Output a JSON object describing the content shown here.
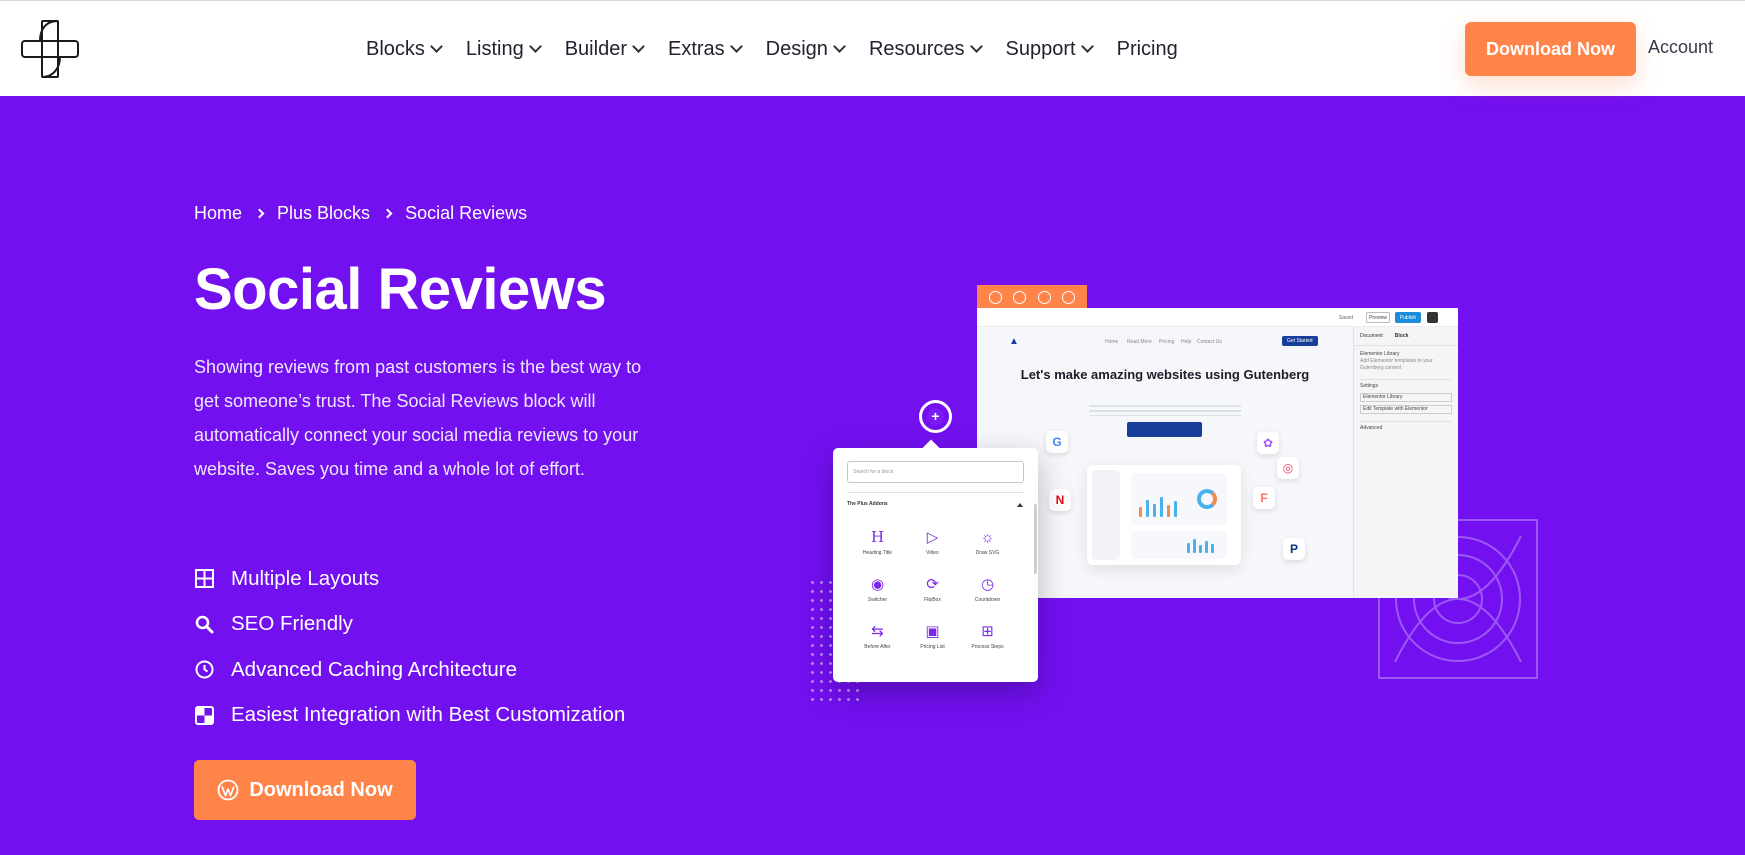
{
  "header": {
    "nav": [
      {
        "label": "Blocks",
        "dropdown": true
      },
      {
        "label": "Listing",
        "dropdown": true
      },
      {
        "label": "Builder",
        "dropdown": true
      },
      {
        "label": "Extras",
        "dropdown": true
      },
      {
        "label": "Design",
        "dropdown": true
      },
      {
        "label": "Resources",
        "dropdown": true
      },
      {
        "label": "Support",
        "dropdown": true
      },
      {
        "label": "Pricing",
        "dropdown": false
      }
    ],
    "download_button": "Download Now",
    "account_link": "Account"
  },
  "breadcrumb": [
    "Home",
    "Plus Blocks",
    "Social Reviews"
  ],
  "hero": {
    "title": "Social Reviews",
    "description": "Showing reviews from past customers is the best way to get someone’s trust. The Social Reviews block will automatically connect your social media reviews to your website. Saves you time and a whole lot of effort.",
    "features": [
      {
        "label": "Multiple Layouts",
        "icon": "layout-grid-icon"
      },
      {
        "label": "SEO Friendly",
        "icon": "search-icon"
      },
      {
        "label": "Advanced Caching Architecture",
        "icon": "clock-icon"
      },
      {
        "label": "Easiest Integration with Best Customization",
        "icon": "integration-icon"
      }
    ],
    "cta_label": "Download Now"
  },
  "mockup": {
    "editor_headline": "Let's make amazing websites using Gutenberg",
    "editor_topbar": [
      "Saved",
      "Preview",
      "Publish"
    ],
    "editor_nav": [
      "Home",
      "Read More",
      "Pricing",
      "Help",
      "Contact Us",
      "Get Started"
    ],
    "panel_tabs": [
      "Document",
      "Block"
    ],
    "panel_items": [
      "Elementor Library",
      "Add Elementor templates to your Gutenberg content",
      "Settings",
      "Elementor Library",
      "Edit Template with Elementor",
      "Advanced"
    ],
    "inserter_search_placeholder": "Search for a block",
    "inserter_section": "The Plus Addons",
    "inserter_blocks": [
      {
        "label": "Heading Title",
        "icon": "heading-icon"
      },
      {
        "label": "Video",
        "icon": "video-icon"
      },
      {
        "label": "Draw SVG",
        "icon": "bulb-icon"
      },
      {
        "label": "Switcher",
        "icon": "switcher-icon"
      },
      {
        "label": "FlipBox",
        "icon": "flipbox-icon"
      },
      {
        "label": "Countdown",
        "icon": "countdown-icon"
      },
      {
        "label": "Before After",
        "icon": "before-after-icon"
      },
      {
        "label": "Pricing List",
        "icon": "pricing-list-icon"
      },
      {
        "label": "Process Steps",
        "icon": "process-steps-icon"
      }
    ]
  },
  "colors": {
    "hero_bg": "#7210f0",
    "accent": "#ff844a",
    "header_bg": "#ffffff",
    "nav_text": "#222230"
  }
}
